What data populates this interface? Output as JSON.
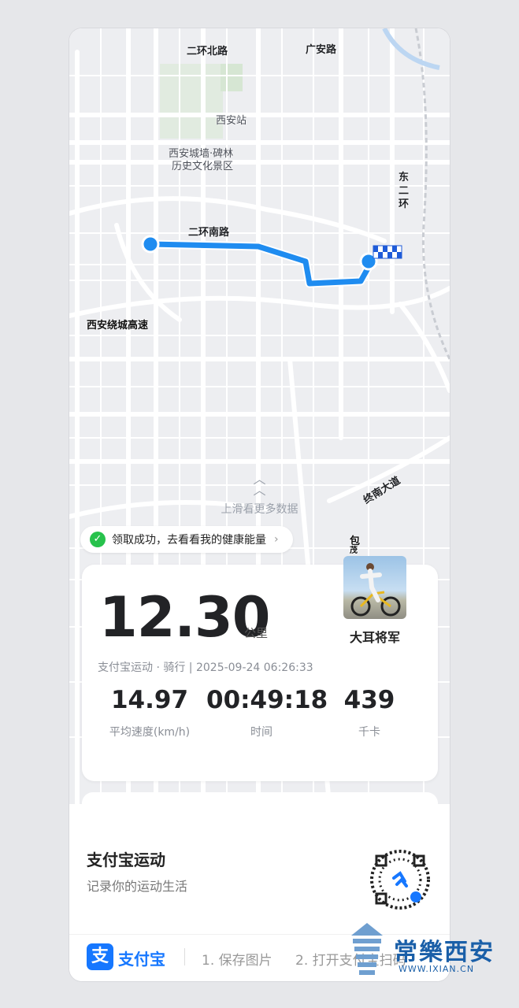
{
  "map": {
    "labels": {
      "erhuan_north": "二环北路",
      "guangan": "广安路",
      "xian_station": "西安站",
      "scenic_line1": "西安城墙·碑林",
      "scenic_line2": "历史文化景区",
      "dong_erhuan_1": "东",
      "dong_erhuan_2": "二",
      "dong_erhuan_3": "环",
      "erhuan_south": "二环南路",
      "ring_expressway": "西安绕城高速",
      "zhongnan": "终南大道",
      "bao": "包",
      "mao": "茂"
    },
    "route_color": "#1f8cf0",
    "swipe_hint": "上滑看更多数据"
  },
  "toast": {
    "text": "领取成功，去看看我的健康能量",
    "check_icon": "✓",
    "arrow_icon": "›"
  },
  "activity": {
    "distance": "12.30",
    "unit": "公里",
    "meta": "支付宝运动 · 骑行 | 2025-09-24 06:26:33",
    "metrics": [
      {
        "value": "14.97",
        "label": "平均速度(km/h)"
      },
      {
        "value": "00:49:18",
        "label": "时间"
      },
      {
        "value": "439",
        "label": "千卡"
      }
    ]
  },
  "user": {
    "name": "大耳将军"
  },
  "promo": {
    "title": "支付宝运动",
    "subtitle": "记录你的运动生活"
  },
  "footer": {
    "logo_char": "支",
    "brand": "支付宝",
    "step1": "1. 保存图片",
    "step2": "2. 打开支付宝扫码"
  },
  "watermark": {
    "text": "常樂西安",
    "url": "WWW.IXIAN.CN"
  }
}
